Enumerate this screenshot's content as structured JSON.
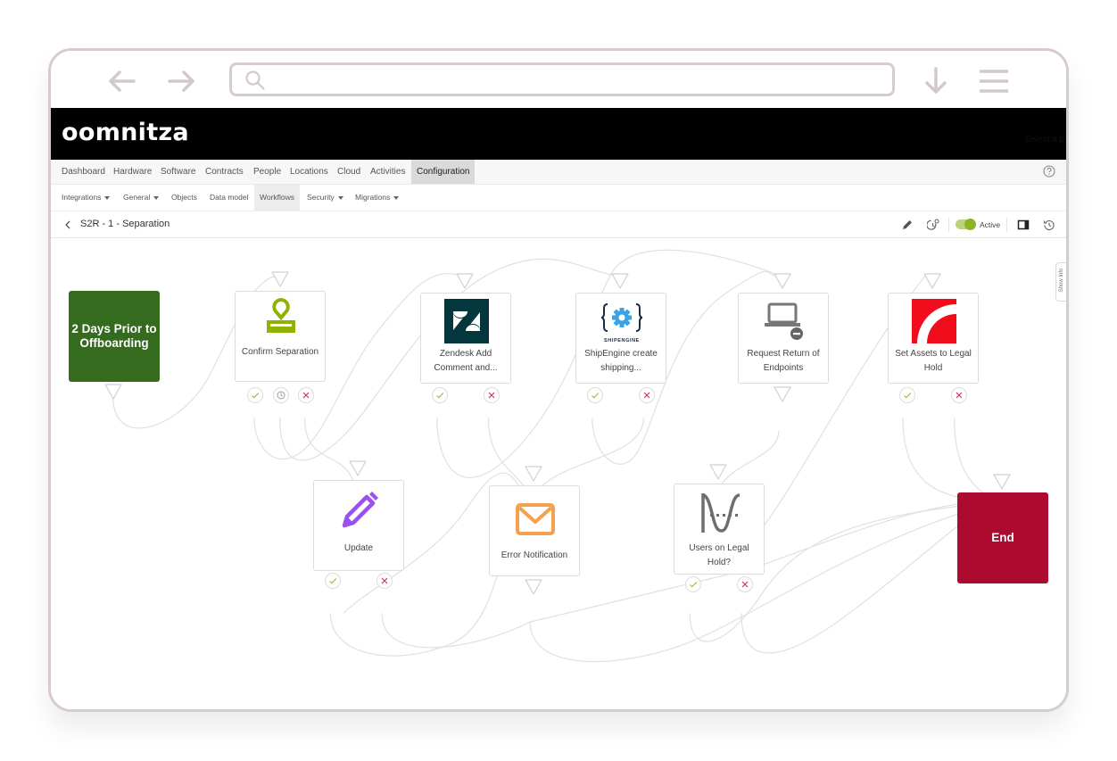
{
  "browser": {
    "back_icon": "arrow-left-icon",
    "forward_icon": "arrow-right-icon",
    "search_icon": "search-icon",
    "url_value": "",
    "download_icon": "arrow-down-icon",
    "menu_icon": "hamburger-menu-icon"
  },
  "brand": {
    "logo_text": "oomnitza",
    "hint_text": "Select a p"
  },
  "main_nav": {
    "items": [
      {
        "label": "Dashboard"
      },
      {
        "label": "Hardware"
      },
      {
        "label": "Software"
      },
      {
        "label": "Contracts"
      },
      {
        "label": "People"
      },
      {
        "label": "Locations"
      },
      {
        "label": "Cloud"
      },
      {
        "label": "Activities"
      },
      {
        "label": "Configuration",
        "active": true
      }
    ],
    "help_icon": "help-circle-icon"
  },
  "sub_nav": {
    "items": [
      {
        "label": "Integrations",
        "dropdown": true
      },
      {
        "label": "General",
        "dropdown": true
      },
      {
        "label": "Objects"
      },
      {
        "label": "Data model"
      },
      {
        "label": "Workflows",
        "active": true
      },
      {
        "label": "Security",
        "dropdown": true
      },
      {
        "label": "Migrations",
        "dropdown": true
      }
    ]
  },
  "workflow": {
    "title": "S2R - 1 - Separation",
    "status_label": "Active",
    "status_active": true,
    "toolbar_icons": [
      "pencil-icon",
      "schedule-settings-icon",
      "toggle-switch",
      "side-panel-icon",
      "history-icon"
    ]
  },
  "canvas": {
    "show_info_label": "Show Info",
    "nodes": [
      {
        "id": "start",
        "label": "2 Days Prior to Offboarding",
        "type": "start",
        "color": "#346b1f"
      },
      {
        "id": "confirm",
        "label": "Confirm Separation",
        "icon": "stamp-icon",
        "icon_color": "#8fb300",
        "outcomes": [
          "success",
          "timeout",
          "failure"
        ]
      },
      {
        "id": "zendesk",
        "label": "Zendesk Add Comment and...",
        "icon": "zendesk-logo-icon",
        "icon_color": "#03363d",
        "outcomes": [
          "success",
          "failure"
        ]
      },
      {
        "id": "shipengine",
        "label": "ShipEngine create shipping...",
        "icon": "shipengine-logo-icon",
        "icon_color": "#3aa3e3",
        "icon_caption": "SHIPENGINE",
        "outcomes": [
          "success",
          "failure"
        ]
      },
      {
        "id": "return",
        "label": "Request Return of Endpoints",
        "icon": "laptop-remove-icon",
        "icon_color": "#777777",
        "outcomes": []
      },
      {
        "id": "legalhold",
        "label": "Set Assets to Legal Hold",
        "icon": "legal-hold-logo-icon",
        "icon_color": "#f10d1c",
        "outcomes": [
          "success",
          "failure"
        ]
      },
      {
        "id": "update",
        "label": "Update",
        "icon": "pencil-icon",
        "icon_color": "#9a52ea",
        "outcomes": [
          "success",
          "failure"
        ]
      },
      {
        "id": "error",
        "label": "Error Notification",
        "icon": "envelope-icon",
        "icon_color": "#f4a04c",
        "outcomes": []
      },
      {
        "id": "users",
        "label": "Users on Legal Hold?",
        "icon": "condition-curve-icon",
        "icon_color": "#6e6e6e",
        "outcomes": [
          "success",
          "failure"
        ]
      },
      {
        "id": "end",
        "label": "End",
        "type": "end",
        "color": "#ad0a30"
      }
    ],
    "colors": {
      "success": "#9bbf3f",
      "failure": "#c9395a",
      "timeout": "#9a9a9a",
      "edge": "#e0e0e0"
    }
  }
}
